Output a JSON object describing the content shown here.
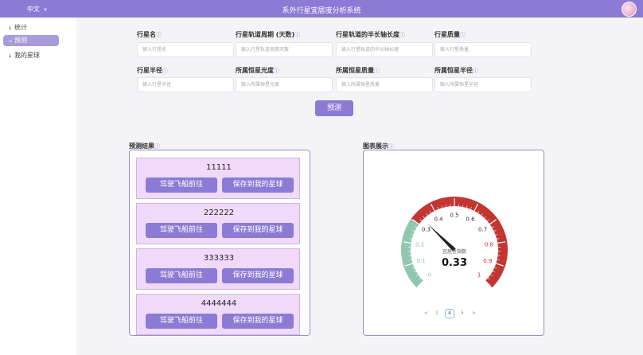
{
  "header": {
    "language": "中文",
    "title": "系外行星宜居度分析系统"
  },
  "sidebar": {
    "items": [
      {
        "label": "统计"
      },
      {
        "label": "预测"
      },
      {
        "label": "我的星球"
      }
    ],
    "active_index": 1
  },
  "form": {
    "fields": [
      {
        "label": "行星名",
        "placeholder": "输入行星名"
      },
      {
        "label": "行星轨道周期 (天数)",
        "placeholder": "输入行星轨道周期天数"
      },
      {
        "label": "行星轨道的半长轴长度",
        "placeholder": "输入行星轨道的半长轴长度"
      },
      {
        "label": "行星质量",
        "placeholder": "输入行星质量"
      },
      {
        "label": "行星半径",
        "placeholder": "输入行星半径"
      },
      {
        "label": "所属恒星光度",
        "placeholder": "输入所属恒星光度"
      },
      {
        "label": "所属恒星质量",
        "placeholder": "输入所属恒星质量"
      },
      {
        "label": "所属恒星半径",
        "placeholder": "输入所属恒星半径"
      }
    ],
    "predict_label": "预测"
  },
  "results": {
    "title": "预测结果",
    "items": [
      {
        "value": "11111"
      },
      {
        "value": "222222"
      },
      {
        "value": "333333"
      },
      {
        "value": "4444444"
      }
    ],
    "drive_label": "驾驶飞船前往",
    "save_label": "保存到我的星球"
  },
  "chart": {
    "title": "图表展示",
    "gauge_label": "宜居性指数",
    "value_text": "0.33",
    "pager": [
      "<",
      "1",
      "4",
      "5",
      ">"
    ],
    "pager_current": "4"
  },
  "chart_data": {
    "type": "gauge",
    "min": 0,
    "max": 1,
    "value": 0.33,
    "ticks": [
      "0",
      "0.1",
      "0.2",
      "0.3",
      "0.4",
      "0.5",
      "0.6",
      "0.7",
      "0.8",
      "0.9",
      "1"
    ],
    "bands": [
      {
        "from": 0,
        "to": 0.3,
        "color": "#91c7ae"
      },
      {
        "from": 0.3,
        "to": 1,
        "color": "#c23531"
      }
    ]
  }
}
